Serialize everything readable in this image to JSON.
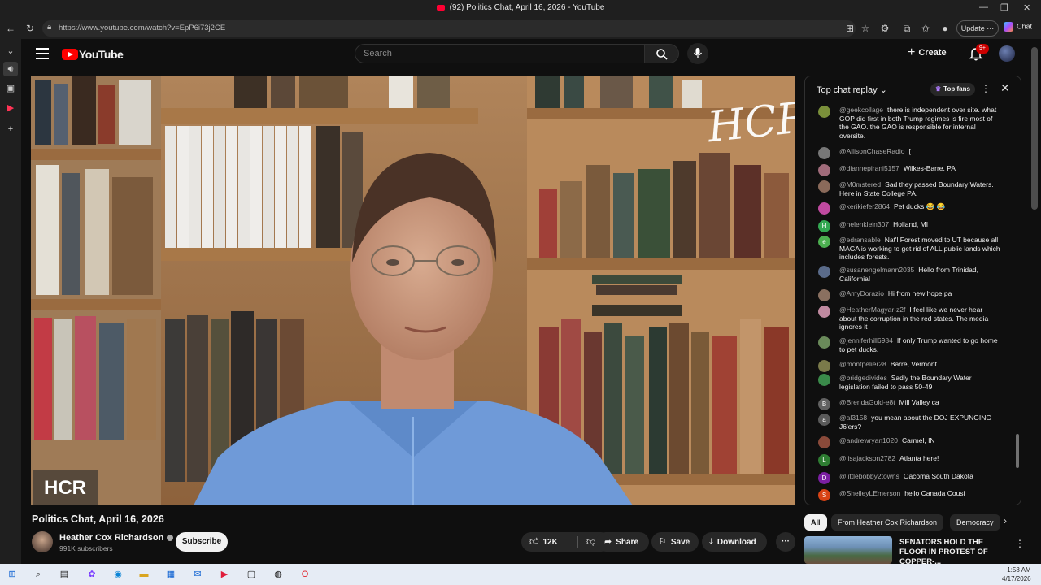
{
  "window": {
    "title": "(92) Politics Chat, April 16, 2026 - YouTube"
  },
  "browser": {
    "url": "https://www.youtube.com/watch?v=EpP6i73j2CE",
    "update_label": "Update",
    "chat_label": "Chat"
  },
  "youtube": {
    "logo_text": "YouTube",
    "search_placeholder": "Search",
    "create_label": "Create",
    "notification_badge": "9+"
  },
  "video": {
    "overlay_badge": "HCR",
    "overlay_signature": "HCR",
    "title": "Politics Chat, April 16, 2026",
    "channel_name": "Heather Cox Richardson",
    "subscribers": "991K subscribers",
    "subscribe_label": "Subscribe",
    "likes": "12K",
    "share_label": "Share",
    "save_label": "Save",
    "download_label": "Download"
  },
  "chat": {
    "header": "Top chat replay",
    "top_fans_label": "Top fans",
    "messages": [
      {
        "author": "@geekcollage",
        "text": "there is independent over site. what GOP did first in both Trump regimes is fire most of the GAO. the GAO is responsible for internal oversite.",
        "initial": "",
        "color": "#7a8f3a"
      },
      {
        "author": "@AllisonChaseRadio",
        "text": "[",
        "initial": "",
        "color": "#777777"
      },
      {
        "author": "@diannepirani5157",
        "text": "Wilkes-Barre, PA",
        "initial": "",
        "color": "#a06b7a"
      },
      {
        "author": "@M0mstered",
        "text": "Sad they passed Boundary Waters. Here in State College PA.",
        "initial": "",
        "color": "#8a6a5a"
      },
      {
        "author": "@kerikiefer2864",
        "text": "Pet ducks 😂 😂",
        "initial": "",
        "color": "#c04aa0"
      },
      {
        "author": "@helenklein307",
        "text": "Holland, MI",
        "initial": "H",
        "color": "#33a852"
      },
      {
        "author": "@edransable",
        "text": "Nat'l Forest moved to UT because all MAGA is working to get rid of ALL public lands which includes forests.",
        "initial": "e",
        "color": "#4caf50"
      },
      {
        "author": "@susanengelmann2035",
        "text": "Hello from Trinidad, California!",
        "initial": "",
        "color": "#5a6b8a"
      },
      {
        "author": "@AmyDorazio",
        "text": "Hi from new hope pa",
        "initial": "",
        "color": "#8a7060"
      },
      {
        "author": "@HeatherMagyar-z2f",
        "text": "I feel like we never hear about the corruption in the red states. The media ignores it",
        "initial": "",
        "color": "#c08aa0"
      },
      {
        "author": "@jenniferhill6984",
        "text": "If only Trump wanted to go home to pet ducks.",
        "initial": "",
        "color": "#6a8a5a"
      },
      {
        "author": "@montpelier28",
        "text": "Barre, Vermont",
        "initial": "",
        "color": "#7a7a4a"
      },
      {
        "author": "@bridgedivides",
        "text": "Sadly the Boundary Water legislation failed to pass 50-49",
        "initial": "",
        "color": "#3a8a4a"
      },
      {
        "author": "@BrendaGold-e8t",
        "text": "Mill Valley ca",
        "initial": "B",
        "color": "#616161"
      },
      {
        "author": "@al3158",
        "text": "you mean about the DOJ EXPUNGING J6'ers?",
        "initial": "a",
        "color": "#5a5a5a"
      },
      {
        "author": "@andrewryan1020",
        "text": "Carmel, IN",
        "initial": "",
        "color": "#8a4a3a"
      },
      {
        "author": "@lisajackson2782",
        "text": "Atlanta here!",
        "initial": "L",
        "color": "#2e7d32"
      },
      {
        "author": "@littlebobby2towns",
        "text": "Oacoma South Dakota",
        "initial": "D",
        "color": "#7b1fa2"
      },
      {
        "author": "@ShelleyLEmerson",
        "text": "hello Canada Cousi",
        "initial": "S",
        "color": "#d84315"
      }
    ]
  },
  "chips": [
    "All",
    "From Heather Cox Richardson",
    "Democracy"
  ],
  "recommendation": {
    "title": "SENATORS HOLD THE FLOOR IN PROTEST OF COPPER-..."
  },
  "taskbar": {
    "time": "1:58 AM",
    "date": "4/17/2026"
  }
}
